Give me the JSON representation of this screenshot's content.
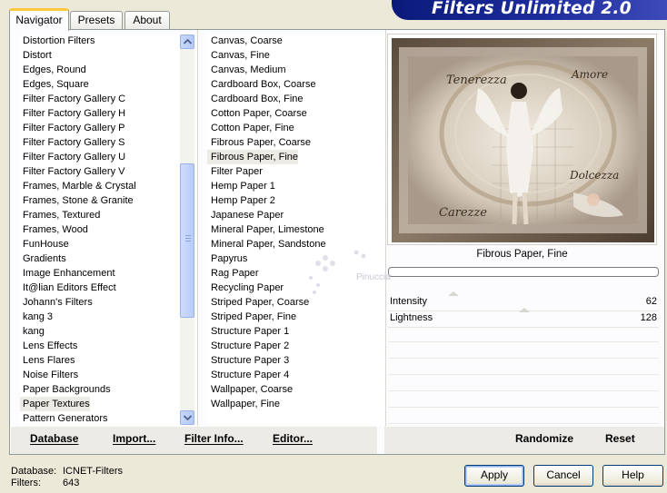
{
  "tabs": [
    {
      "label": "Navigator",
      "active": true
    },
    {
      "label": "Presets",
      "active": false
    },
    {
      "label": "About",
      "active": false
    }
  ],
  "banner": {
    "title": "Filters Unlimited 2.0"
  },
  "categories": [
    "Distortion Filters",
    "Distort",
    "Edges, Round",
    "Edges, Square",
    "Filter Factory Gallery C",
    "Filter Factory Gallery H",
    "Filter Factory Gallery P",
    "Filter Factory Gallery S",
    "Filter Factory Gallery U",
    "Filter Factory Gallery V",
    "Frames, Marble & Crystal",
    "Frames, Stone & Granite",
    "Frames, Textured",
    "Frames, Wood",
    "FunHouse",
    "Gradients",
    "Image Enhancement",
    "It@lian Editors Effect",
    "Johann's Filters",
    "kang 3",
    "kang",
    "Lens Effects",
    "Lens Flares",
    "Noise Filters",
    "Paper Backgrounds",
    "Paper Textures",
    "Pattern Generators"
  ],
  "selected_category": "Paper Textures",
  "filters": [
    "Canvas, Coarse",
    "Canvas, Fine",
    "Canvas, Medium",
    "Cardboard Box, Coarse",
    "Cardboard Box, Fine",
    "Cotton Paper, Coarse",
    "Cotton Paper, Fine",
    "Fibrous Paper, Coarse",
    "Fibrous Paper, Fine",
    "Filter Paper",
    "Hemp Paper 1",
    "Hemp Paper 2",
    "Japanese Paper",
    "Mineral Paper, Limestone",
    "Mineral Paper, Sandstone",
    "Papyrus",
    "Rag Paper",
    "Recycling Paper",
    "Striped Paper, Coarse",
    "Striped Paper, Fine",
    "Structure Paper 1",
    "Structure Paper 2",
    "Structure Paper 3",
    "Structure Paper 4",
    "Wallpaper, Coarse",
    "Wallpaper, Fine"
  ],
  "selected_filter": "Fibrous Paper, Fine",
  "preview": {
    "filter_name": "Fibrous Paper, Fine",
    "texts": [
      "Tenerezza",
      "Amore",
      "Dolcezza",
      "Carezze"
    ],
    "watermark": "Pinuccia"
  },
  "sliders": [
    {
      "label": "Intensity",
      "value": "62",
      "level": 0.243
    },
    {
      "label": "Lightness",
      "value": "128",
      "level": 0.502
    }
  ],
  "panel_buttons": {
    "database": "Database",
    "import": "Import...",
    "filter_info": "Filter Info...",
    "editor": "Editor...",
    "randomize": "Randomize",
    "reset": "Reset"
  },
  "status": {
    "database_label": "Database:",
    "database_value": "ICNET-Filters",
    "filters_label": "Filters:",
    "filters_value": "643"
  },
  "dialog_buttons": {
    "apply": "Apply",
    "cancel": "Cancel",
    "help": "Help"
  },
  "colors": {
    "banner": "#1d2c9c",
    "tab_highlight": "#ffc83c",
    "scrollbar": "#b8cbf8"
  }
}
